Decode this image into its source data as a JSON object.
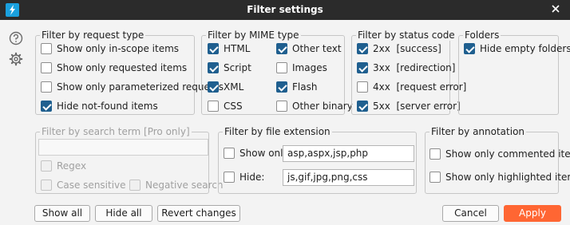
{
  "window": {
    "title": "Filter settings",
    "app_icon": "lightning-icon",
    "close_icon": "close-icon"
  },
  "sidebar": {
    "help_icon": "help-icon",
    "settings_icon": "gear-icon"
  },
  "request_type": {
    "legend": "Filter by request type",
    "items": [
      {
        "label": "Show only in-scope items",
        "checked": false
      },
      {
        "label": "Show only requested items",
        "checked": false
      },
      {
        "label": "Show only parameterized requests",
        "checked": false
      },
      {
        "label": "Hide not-found items",
        "checked": true
      }
    ]
  },
  "mime_type": {
    "legend": "Filter by MIME type",
    "items": [
      {
        "label": "HTML",
        "checked": true
      },
      {
        "label": "Other text",
        "checked": true
      },
      {
        "label": "Script",
        "checked": true
      },
      {
        "label": "Images",
        "checked": false
      },
      {
        "label": "XML",
        "checked": true
      },
      {
        "label": "Flash",
        "checked": true
      },
      {
        "label": "CSS",
        "checked": false
      },
      {
        "label": "Other binary",
        "checked": false
      }
    ]
  },
  "status_code": {
    "legend": "Filter by status code",
    "items": [
      {
        "label": "2xx  [success]",
        "checked": true
      },
      {
        "label": "3xx  [redirection]",
        "checked": true
      },
      {
        "label": "4xx  [request error]",
        "checked": false
      },
      {
        "label": "5xx  [server error]",
        "checked": true
      }
    ]
  },
  "folders": {
    "legend": "Folders",
    "items": [
      {
        "label": "Hide empty folders",
        "checked": true
      }
    ]
  },
  "search_term": {
    "legend": "Filter by search term [Pro only]",
    "value": "",
    "regex": "Regex",
    "case_sensitive": "Case sensitive",
    "negative_search": "Negative search"
  },
  "file_extension": {
    "legend": "Filter by file extension",
    "show_only_label": "Show only:",
    "show_only_checked": false,
    "show_only_value": "asp,aspx,jsp,php",
    "hide_label": "Hide:",
    "hide_checked": false,
    "hide_value": "js,gif,jpg,png,css"
  },
  "annotation": {
    "legend": "Filter by annotation",
    "items": [
      {
        "label": "Show only commented items",
        "checked": false
      },
      {
        "label": "Show only highlighted items",
        "checked": false
      }
    ]
  },
  "buttons": {
    "show_all": "Show all",
    "hide_all": "Hide all",
    "revert": "Revert changes",
    "cancel": "Cancel",
    "apply": "Apply"
  },
  "colors": {
    "accent": "#ff6633",
    "checkbox_checked": "#1f5f8f",
    "titlebar": "#2b2b2b"
  }
}
